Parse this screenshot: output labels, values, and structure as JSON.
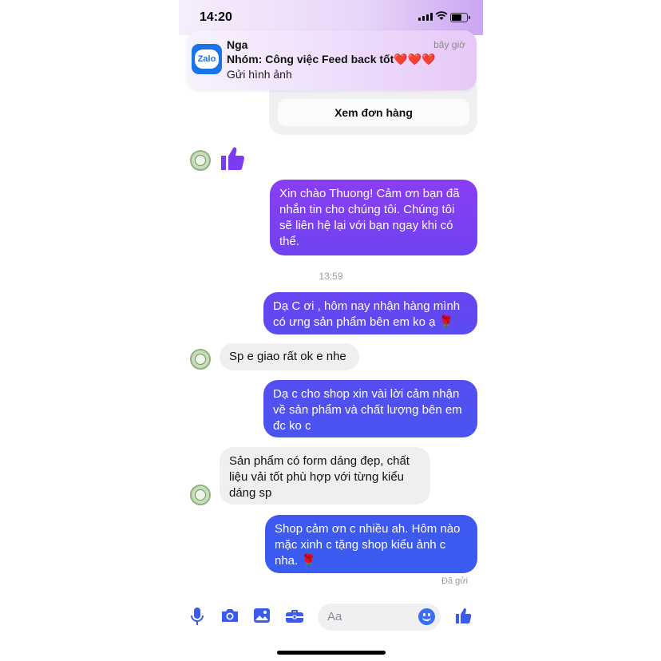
{
  "status_bar": {
    "time": "14:20"
  },
  "notification": {
    "app_icon_label": "Zalo",
    "sender": "Nga",
    "time": "bây giờ",
    "group": "Nhóm: Công việc Feed back tốt❤️❤️❤️",
    "body": "Gửi hình ảnh"
  },
  "order_card": {
    "button_label": "Xem đơn hàng"
  },
  "messages": [
    {
      "direction": "sent",
      "text": "Xin chào Thuong! Cảm ơn bạn đã nhắn tin cho chúng tôi. Chúng tôi sẽ liên hệ lại với bạn ngay khi có thể."
    },
    {
      "direction": "sent",
      "text": "Dạ C ơi , hôm nay  nhận hàng mình có ưng sản phẩm bên em ko ạ 🌹"
    },
    {
      "direction": "received",
      "text": "Sp e giao rất ok e nhe"
    },
    {
      "direction": "sent",
      "text": "Dạ c cho shop xin vài lời cảm nhận về sản phẩm và chất lượng bên em đc ko c"
    },
    {
      "direction": "received",
      "text": "Sản phẩm có form dáng đẹp, chất liệu vải tốt phù hợp với từng kiểu dáng sp"
    },
    {
      "direction": "sent",
      "text": "Shop cảm ơn c nhiều ah. Hôm nào mặc xinh c tặng shop kiểu ảnh c nha. 🌹"
    }
  ],
  "timestamp": "13:59",
  "delivery_status": "Đã gửi",
  "composer": {
    "placeholder": "Aa",
    "icons": [
      "microphone-icon",
      "camera-icon",
      "gallery-icon",
      "briefcase-icon",
      "emoji-icon",
      "thumbs-up-icon"
    ]
  },
  "colors": {
    "accent_purple": "#7a3cf2",
    "accent_blue": "#3b5bf0",
    "received_bubble": "#efeff1"
  }
}
